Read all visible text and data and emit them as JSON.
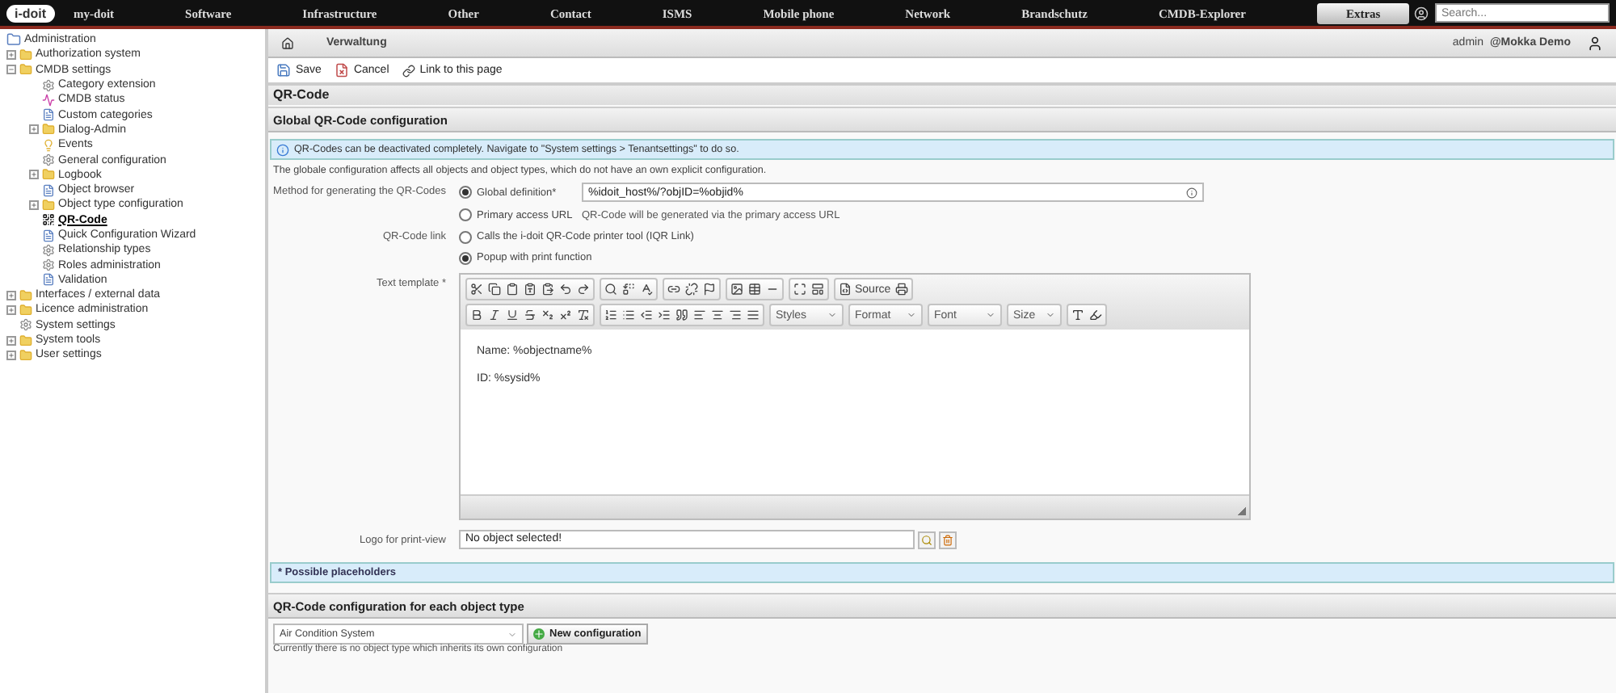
{
  "nav": {
    "logo": "i-doit",
    "items": [
      {
        "label": "my-doit",
        "selected": false
      },
      {
        "label": "Software",
        "selected": false
      },
      {
        "label": "Infrastructure",
        "selected": false
      },
      {
        "label": "Other",
        "selected": false
      },
      {
        "label": "Contact",
        "selected": false
      },
      {
        "label": "ISMS",
        "selected": false
      },
      {
        "label": "Mobile phone",
        "selected": false
      },
      {
        "label": "Network",
        "selected": false
      },
      {
        "label": "Brandschutz",
        "selected": false
      },
      {
        "label": "CMDB-Explorer",
        "selected": false
      },
      {
        "label": "Extras",
        "selected": true
      }
    ],
    "search": {
      "placeholder": "Search..."
    }
  },
  "sidebar": {
    "root": "Administration",
    "items": [
      {
        "label": "Authorization system",
        "kind": "folder",
        "expanded": false,
        "selected": false
      },
      {
        "label": "CMDB settings",
        "kind": "folder",
        "expanded": true,
        "selected": false,
        "children": [
          {
            "label": "Category extension",
            "kind": "gear",
            "selected": false
          },
          {
            "label": "CMDB status",
            "kind": "status",
            "selected": false
          },
          {
            "label": "Custom categories",
            "kind": "page",
            "selected": false
          },
          {
            "label": "Dialog-Admin",
            "kind": "folder",
            "expanded": false,
            "selected": false
          },
          {
            "label": "Events",
            "kind": "bulb",
            "selected": false
          },
          {
            "label": "General configuration",
            "kind": "gear",
            "selected": false
          },
          {
            "label": "Logbook",
            "kind": "folder",
            "expanded": false,
            "selected": false
          },
          {
            "label": "Object browser",
            "kind": "page",
            "selected": false
          },
          {
            "label": "Object type configuration",
            "kind": "folder",
            "expanded": false,
            "selected": false
          },
          {
            "label": "QR-Code",
            "kind": "qr",
            "selected": true
          },
          {
            "label": "Quick Configuration Wizard",
            "kind": "page",
            "selected": false
          },
          {
            "label": "Relationship types",
            "kind": "gear",
            "selected": false
          },
          {
            "label": "Roles administration",
            "kind": "gear",
            "selected": false
          },
          {
            "label": "Validation",
            "kind": "page",
            "selected": false
          }
        ]
      },
      {
        "label": "Interfaces / external data",
        "kind": "folder",
        "expanded": false,
        "selected": false
      },
      {
        "label": "Licence administration",
        "kind": "folder",
        "expanded": false,
        "selected": false
      },
      {
        "label": "System settings",
        "kind": "gear",
        "selected": false
      },
      {
        "label": "System tools",
        "kind": "folder",
        "expanded": false,
        "selected": false
      },
      {
        "label": "User settings",
        "kind": "folder",
        "expanded": false,
        "selected": false
      }
    ]
  },
  "breadcrumb": [
    "Verwaltung"
  ],
  "user": {
    "name": "admin",
    "tenant": "@Mokka Demo"
  },
  "actions": [
    {
      "label": "Save",
      "kind": "save"
    },
    {
      "label": "Cancel",
      "kind": "cancel"
    },
    {
      "label": "Link to this page",
      "kind": "link"
    }
  ],
  "page_title": "QR-Code",
  "section_title": "Global QR-Code configuration",
  "info": "QR-Codes can be deactivated completely. Navigate to \"System settings > Tenantsettings\" to do so.",
  "description": "The globale configuration affects all objects and object types, which do not have an own explicit configuration.",
  "method": {
    "label": "Method for generating the QR-Codes",
    "options": [
      {
        "label": "Global definition*",
        "selected": true,
        "value": "%idoit_host%/?objID=%objid%"
      },
      {
        "label": "Primary access URL",
        "selected": false,
        "note": "QR-Code will be generated via the primary access URL"
      }
    ]
  },
  "link": {
    "label": "QR-Code link",
    "options": [
      {
        "label": "Calls the i-doit QR-Code printer tool (IQR Link)",
        "selected": false
      },
      {
        "label": "Popup with print function",
        "selected": true
      }
    ]
  },
  "template": {
    "label": "Text template *",
    "source_button": "Source",
    "dropdowns": [
      "Styles",
      "Format",
      "Font",
      "Size"
    ],
    "lines": [
      "Name: %objectname%",
      "ID: %sysid%"
    ]
  },
  "logo": {
    "label": "Logo for print-view",
    "value": "No object selected!"
  },
  "placeholders": "* Possible placeholders",
  "per_type": {
    "title": "QR-Code configuration for each object type",
    "select": "Air Condition System",
    "button": "New configuration",
    "note": "Currently there is no object type which inherits its own configuration"
  }
}
